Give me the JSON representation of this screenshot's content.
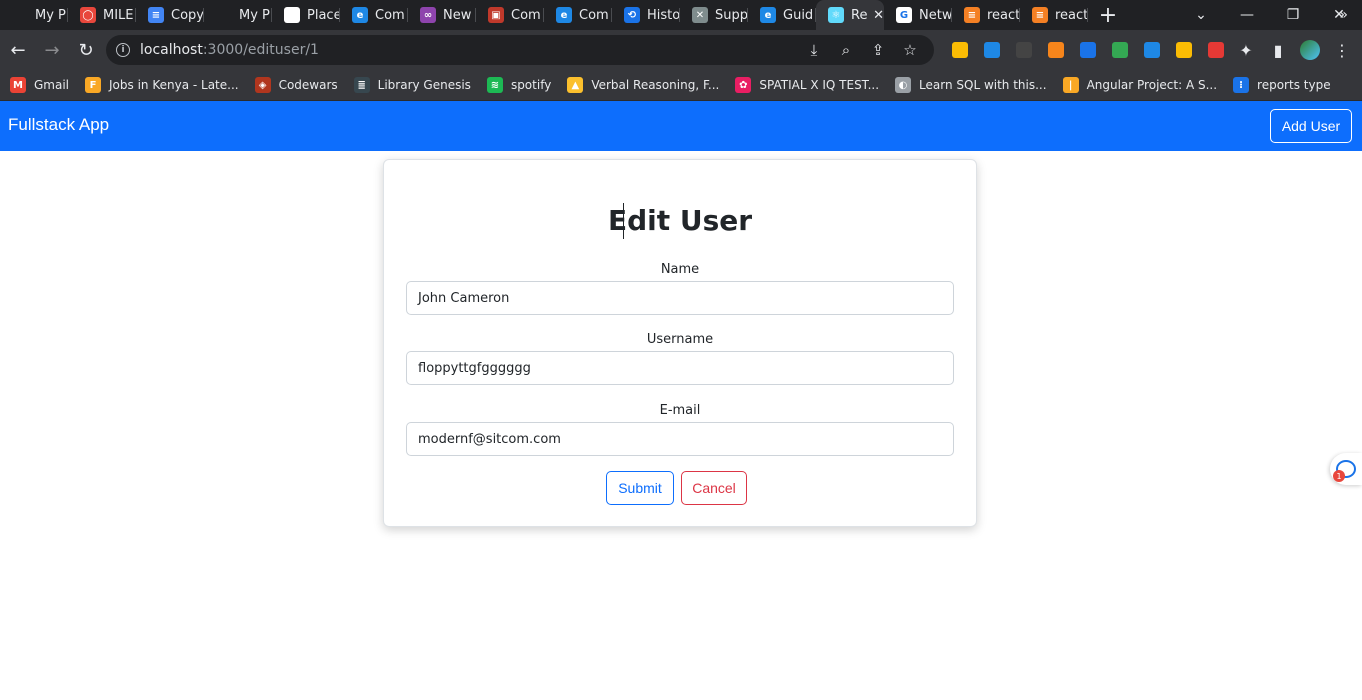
{
  "browser": {
    "tabs": [
      {
        "label": "My P",
        "color": "#202124",
        "glyph": ""
      },
      {
        "label": "MILE",
        "color": "#e8473c",
        "glyph": "◯"
      },
      {
        "label": "Copy",
        "color": "#4285f4",
        "glyph": "≡"
      },
      {
        "label": "My P",
        "color": "#202124",
        "glyph": ""
      },
      {
        "label": "Place",
        "color": "#ffffff",
        "glyph": ""
      },
      {
        "label": "Com",
        "color": "#1e88e5",
        "glyph": "e"
      },
      {
        "label": "New",
        "color": "#8e44ad",
        "glyph": "∞"
      },
      {
        "label": "Com",
        "color": "#c0392b",
        "glyph": "▣"
      },
      {
        "label": "Com",
        "color": "#1e88e5",
        "glyph": "e"
      },
      {
        "label": "Histo",
        "color": "#1a73e8",
        "glyph": "⟲"
      },
      {
        "label": "Supp",
        "color": "#7f8c8d",
        "glyph": "✕"
      },
      {
        "label": "Guid",
        "color": "#1e88e5",
        "glyph": "e"
      },
      {
        "label": "Re",
        "color": "#61dafb",
        "glyph": "⚛",
        "active": true
      },
      {
        "label": "Netw",
        "color": "#ffffff",
        "glyph": "G"
      },
      {
        "label": "react",
        "color": "#f48024",
        "glyph": "≡"
      },
      {
        "label": "react",
        "color": "#f48024",
        "glyph": "≡"
      }
    ],
    "new_tab": "+",
    "window_controls": {
      "chevron": "⌄",
      "minimize": "—",
      "restore": "❐",
      "close": "✕"
    },
    "nav": {
      "back": "←",
      "forward": "→",
      "reload": "↻"
    },
    "address": {
      "host": "localhost",
      "path": ":3000/edituser/1",
      "info_icon": "i"
    },
    "omnibox_icons": {
      "install": "⤓",
      "zoom": "⌕",
      "share": "⇪",
      "star": "☆"
    },
    "extensions": [
      {
        "name": "notes-ext-icon",
        "color": "#fbbc04"
      },
      {
        "name": "fi-ext-icon",
        "color": "#1e88e5"
      },
      {
        "name": "x-ext-icon",
        "color": "#444444"
      },
      {
        "name": "metamask-icon",
        "color": "#f6851b"
      },
      {
        "name": "grid-ext-icon",
        "color": "#1a73e8"
      },
      {
        "name": "drive-ext-icon",
        "color": "#34a853"
      },
      {
        "name": "edge-ext-icon",
        "color": "#1e88e5"
      },
      {
        "name": "chrome-ext-icon",
        "color": "#fbbc04"
      },
      {
        "name": "red-ext-icon",
        "color": "#e53935"
      }
    ],
    "toolbar_right": {
      "puzzle": "✦",
      "sidepanel": "▮",
      "menu": "⋮"
    },
    "bookmarks": [
      {
        "label": "Gmail",
        "color": "#ea4335",
        "glyph": "M"
      },
      {
        "label": "Jobs in Kenya - Late...",
        "color": "#f9a825",
        "glyph": "F"
      },
      {
        "label": "Codewars",
        "color": "#b1361e",
        "glyph": "◈"
      },
      {
        "label": "Library Genesis",
        "color": "#37474f",
        "glyph": "≣"
      },
      {
        "label": "spotify",
        "color": "#1db954",
        "glyph": "≋"
      },
      {
        "label": "Verbal Reasoning, F...",
        "color": "#fbc02d",
        "glyph": "▲"
      },
      {
        "label": "SPATIAL X IQ TEST...",
        "color": "#e91e63",
        "glyph": "✿"
      },
      {
        "label": "Learn SQL with this...",
        "color": "#9aa0a6",
        "glyph": "◐"
      },
      {
        "label": "Angular Project: A S...",
        "color": "#f9a825",
        "glyph": "|"
      },
      {
        "label": "reports type",
        "color": "#1a73e8",
        "glyph": "⁝"
      }
    ],
    "bookmarks_more": "»"
  },
  "app": {
    "brand": "Fullstack App",
    "add_user_label": "Add User",
    "form": {
      "title": "Edit User",
      "name_label": "Name",
      "name_value": "John Cameron",
      "username_label": "Username",
      "username_value": "floppyttgfgggggg",
      "email_label": "E-mail",
      "email_value": "modernf@sitcom.com",
      "submit_label": "Submit",
      "cancel_label": "Cancel"
    },
    "helper_badge": "1"
  }
}
